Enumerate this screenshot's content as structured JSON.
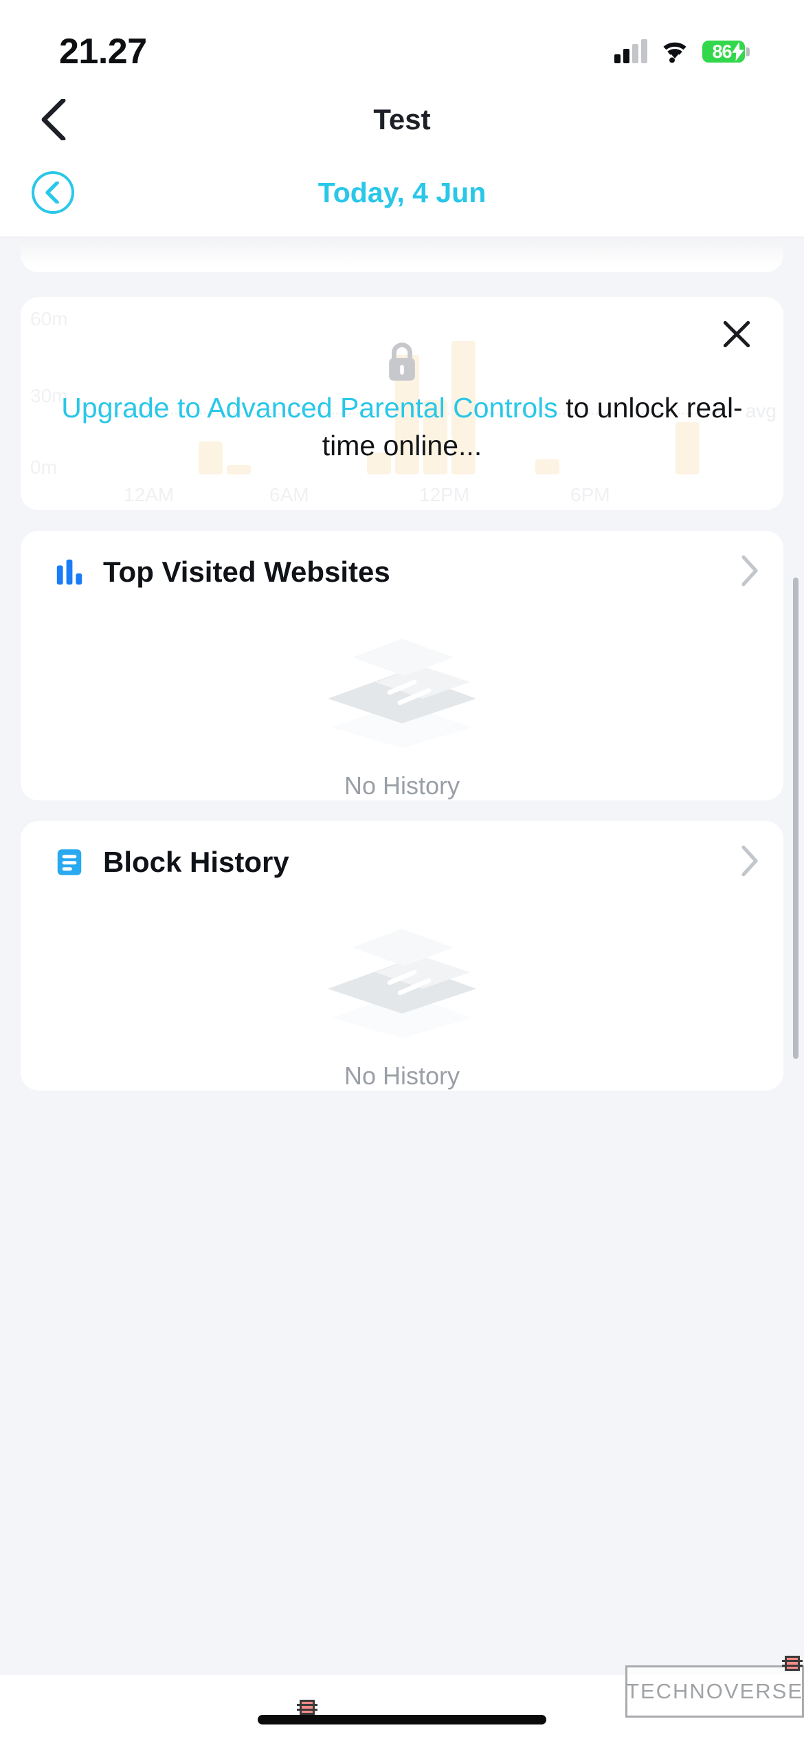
{
  "status_bar": {
    "time": "21.27",
    "battery_percent": "86",
    "icons": {
      "signal": "cellular-signal-icon",
      "wifi": "wifi-icon",
      "battery": "battery-charging-icon"
    }
  },
  "nav": {
    "title": "Test",
    "back_icon": "chevron-left-icon"
  },
  "date_selector": {
    "label": "Today, 4 Jun",
    "prev_icon": "circle-chevron-left-icon",
    "accent_color": "#29c7e8"
  },
  "upgrade_card": {
    "close_icon": "close-icon",
    "lock_icon": "lock-icon",
    "highlight_text": "Upgrade to Advanced Parental",
    "highlight_text_2": "Controls",
    "body_text": " to unlock real-time online...",
    "highlight_color": "#29c7e8",
    "background_chart": {
      "y_labels": [
        "60m",
        "30m",
        "0m"
      ],
      "x_labels": [
        "12AM",
        "6AM",
        "12PM",
        "6PM"
      ],
      "avg_label": "avg"
    }
  },
  "sections": [
    {
      "title": "Top Visited Websites",
      "icon": "bar-chart-icon",
      "icon_color": "#1a7cf7",
      "chevron_icon": "chevron-right-icon",
      "empty_text": "No History",
      "empty_illustration": "stacked-cards-icon"
    },
    {
      "title": "Block History",
      "icon": "document-lines-icon",
      "icon_color": "#29a9f0",
      "chevron_icon": "chevron-right-icon",
      "empty_text": "No History",
      "empty_illustration": "stacked-cards-icon"
    }
  ],
  "watermark": {
    "text": "TECHNOVERSE"
  },
  "chart_data": {
    "type": "bar",
    "title": "",
    "xlabel": "",
    "ylabel": "",
    "categories": [
      "12AM",
      "",
      "",
      "",
      "",
      "",
      "6AM",
      "",
      "",
      "",
      "",
      "",
      "12PM",
      "",
      "",
      "",
      "",
      "",
      "6PM",
      "",
      "",
      "",
      ""
    ],
    "values": [
      0,
      0,
      0,
      0,
      14,
      3,
      0,
      0,
      0,
      0,
      9,
      52,
      32,
      58,
      0,
      0,
      6,
      0,
      0,
      0,
      0,
      22,
      0,
      0
    ],
    "ylim": [
      0,
      60
    ],
    "y_ticks": [
      "0m",
      "30m",
      "60m"
    ],
    "x_ticks": [
      "12AM",
      "6AM",
      "12PM",
      "6PM"
    ],
    "annotations": [
      "avg"
    ],
    "grid": false,
    "legend": "none"
  }
}
